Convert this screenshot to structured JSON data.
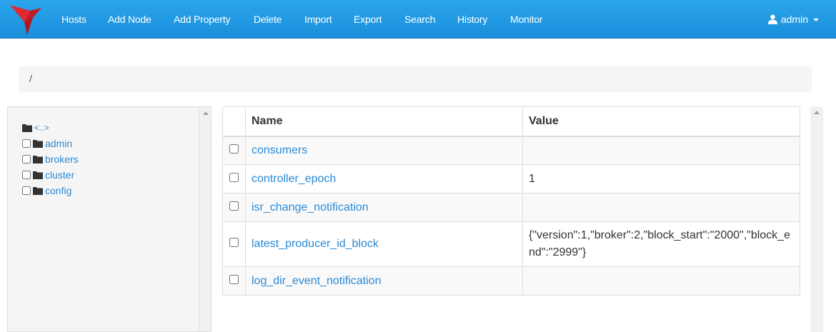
{
  "navbar": {
    "links": [
      "Hosts",
      "Add Node",
      "Add Property",
      "Delete",
      "Import",
      "Export",
      "Search",
      "History",
      "Monitor"
    ],
    "user_label": "admin"
  },
  "breadcrumb": {
    "path": "/"
  },
  "tree": {
    "parent_label": "<..>",
    "items": [
      "admin",
      "brokers",
      "cluster",
      "config"
    ]
  },
  "table": {
    "headers": {
      "name": "Name",
      "value": "Value"
    },
    "rows": [
      {
        "name": "consumers",
        "value": ""
      },
      {
        "name": "controller_epoch",
        "value": "1"
      },
      {
        "name": "isr_change_notification",
        "value": ""
      },
      {
        "name": "latest_producer_id_block",
        "value": "{\"version\":1,\"broker\":2,\"block_start\":\"2000\",\"block_end\":\"2999\"}"
      },
      {
        "name": "log_dir_event_notification",
        "value": ""
      }
    ]
  },
  "colors": {
    "navbar": "#1a8fdb",
    "link": "#2a8ad6",
    "logo": "#d9232e"
  }
}
